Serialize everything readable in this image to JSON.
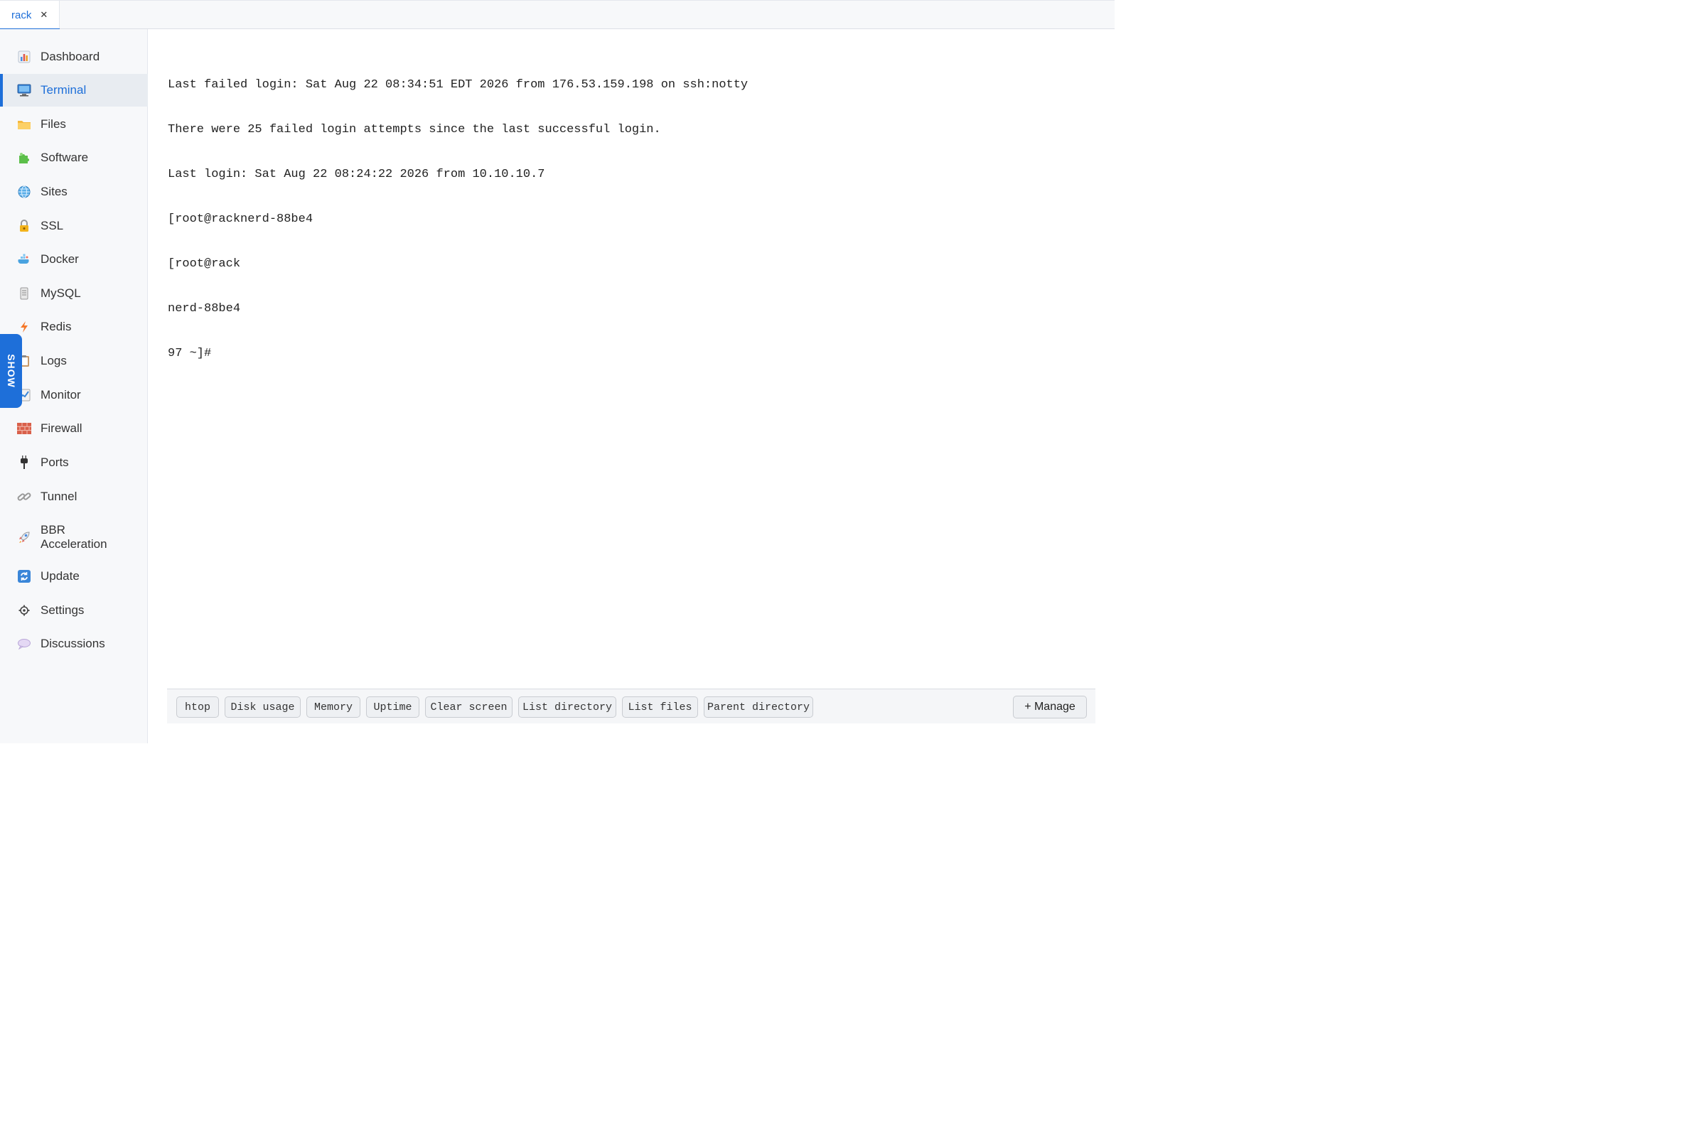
{
  "tab": {
    "label": "rack",
    "close": "✕"
  },
  "sidebar": {
    "items": [
      {
        "label": "Dashboard",
        "icon": "bar-chart-icon"
      },
      {
        "label": "Terminal",
        "icon": "monitor-icon",
        "active": true
      },
      {
        "label": "Files",
        "icon": "folder-icon"
      },
      {
        "label": "Software",
        "icon": "puzzle-icon"
      },
      {
        "label": "Sites",
        "icon": "globe-icon"
      },
      {
        "label": "SSL",
        "icon": "lock-icon"
      },
      {
        "label": "Docker",
        "icon": "whale-icon"
      },
      {
        "label": "MySQL",
        "icon": "database-icon"
      },
      {
        "label": "Redis",
        "icon": "lightning-icon"
      },
      {
        "label": "Logs",
        "icon": "clipboard-icon"
      },
      {
        "label": "Monitor",
        "icon": "trend-chart-icon"
      },
      {
        "label": "Firewall",
        "icon": "brick-wall-icon"
      },
      {
        "label": "Ports",
        "icon": "plug-icon"
      },
      {
        "label": "Tunnel",
        "icon": "link-icon"
      },
      {
        "label": "BBR\nAcceleration",
        "icon": "rocket-icon"
      },
      {
        "label": "Update",
        "icon": "refresh-icon"
      },
      {
        "label": "Settings",
        "icon": "gear-icon"
      },
      {
        "label": "Discussions",
        "icon": "speech-bubble-icon"
      }
    ]
  },
  "show_button": "SHOW",
  "terminal": {
    "lines": [
      "Last failed login: Sat Aug 22 08:34:51 EDT 2026 from 176.53.159.198 on ssh:notty",
      "There were 25 failed login attempts since the last successful login.",
      "Last login: Sat Aug 22 08:24:22 2026 from 10.10.10.7",
      "[root@racknerd-88be4",
      "[root@rack",
      "nerd-88be4",
      "97 ~]#"
    ]
  },
  "quick_commands": [
    "htop",
    "Disk usage",
    "Memory",
    "Uptime",
    "Clear screen",
    "List directory",
    "List files",
    "Parent directory"
  ],
  "manage_label": "+ Manage",
  "colors": {
    "accent": "#1e6fd9",
    "sidebar_bg": "#f7f8fa"
  }
}
